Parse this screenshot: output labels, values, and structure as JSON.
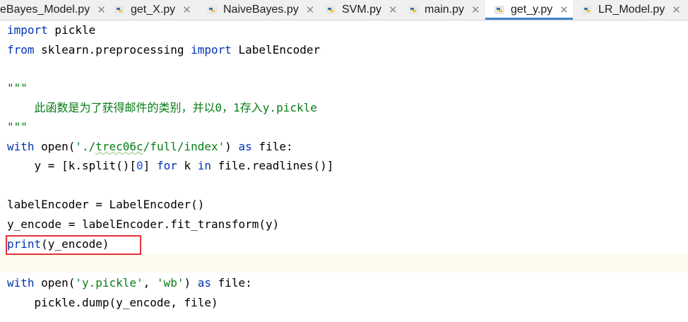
{
  "tabs": [
    {
      "label": "eBayes_Model.py",
      "active": false
    },
    {
      "label": "get_X.py",
      "active": false
    },
    {
      "label": "NaiveBayes.py",
      "active": false
    },
    {
      "label": "SVM.py",
      "active": false
    },
    {
      "label": "main.py",
      "active": false
    },
    {
      "label": "get_y.py",
      "active": true
    },
    {
      "label": "LR_Model.py",
      "active": false
    }
  ],
  "tab_close_glyph": "✕",
  "code": {
    "l1_kw": "import",
    "l1_rest": " pickle",
    "l2_kw1": "from",
    "l2_mid": " sklearn.preprocessing ",
    "l2_kw2": "import",
    "l2_rest": " LabelEncoder",
    "l4_doc": "\"\"\"",
    "l5_doc": "    此函数是为了获得邮件的类别，并以0，1存入y.pickle",
    "l6_doc": "\"\"\"",
    "l7_kw1": "with",
    "l7_a": " open(",
    "l7_str_a": "'./",
    "l7_str_b": "trec06c",
    "l7_str_c": "/full/index'",
    "l7_b": ") ",
    "l7_kw2": "as",
    "l7_c": " file:",
    "l8_a": "    y = [k.split()[",
    "l8_num": "0",
    "l8_b": "] ",
    "l8_kw1": "for",
    "l8_c": " k ",
    "l8_kw2": "in",
    "l8_d": " file.readlines()]",
    "l10": "labelEncoder = LabelEncoder()",
    "l11": "y_encode = labelEncoder.fit_transform(y)",
    "l12_kw": "print",
    "l12_rest": "(y_encode)",
    "l14_kw1": "with",
    "l14_a": " open(",
    "l14_str1": "'y.pickle'",
    "l14_b": ", ",
    "l14_str2": "'wb'",
    "l14_c": ") ",
    "l14_kw2": "as",
    "l14_d": " file:",
    "l15": "    pickle.dump(y_encode, file)"
  },
  "colors": {
    "keyword": "#0033b3",
    "string": "#067d17",
    "number": "#1750eb",
    "highlight_box": "#e0323c",
    "active_tab_underline": "#4083c9"
  },
  "icons": {
    "tab_file_icon": "python-file-icon",
    "tab_close_icon": "close-icon"
  }
}
